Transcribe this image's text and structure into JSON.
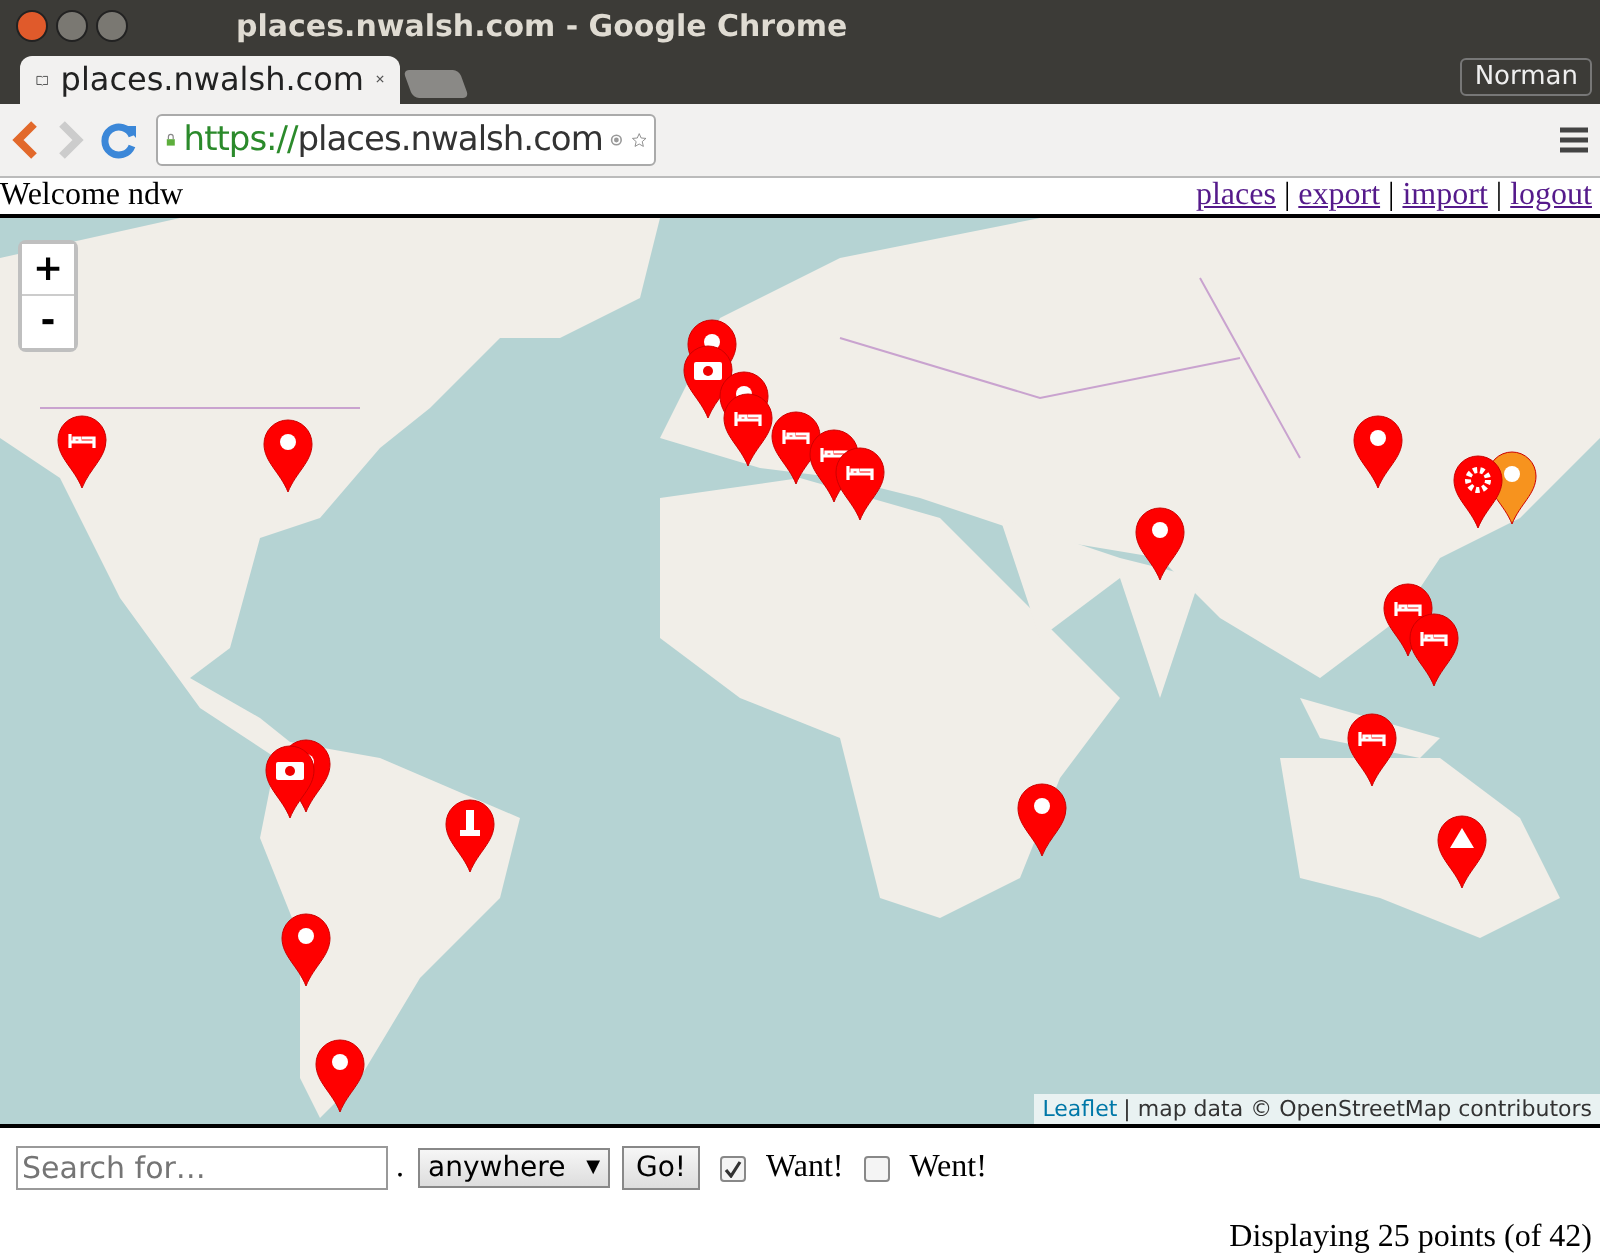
{
  "window": {
    "title": "places.nwalsh.com - Google Chrome"
  },
  "tabs": [
    {
      "label": "places.nwalsh.com",
      "selected": true
    }
  ],
  "profile": "Norman",
  "address_bar": {
    "scheme": "https://",
    "host": "places.nwalsh.com"
  },
  "header": {
    "welcome": "Welcome ndw",
    "links": [
      "places",
      "export",
      "import",
      "logout"
    ],
    "separator": "|"
  },
  "map": {
    "zoom_in": "+",
    "zoom_out": "-",
    "attribution_link": "Leaflet",
    "attribution_text": "| map data © OpenStreetMap contributors"
  },
  "form": {
    "search": {
      "placeholder": "Search for…"
    },
    "dot": ".",
    "scope": {
      "value": "anywhere",
      "arrow": "▼"
    },
    "go": "Go!",
    "checks": [
      {
        "label": "Want!",
        "checked": true
      },
      {
        "label": "Went!",
        "checked": false
      }
    ]
  },
  "status": "Displaying 25 points (of 42)"
}
